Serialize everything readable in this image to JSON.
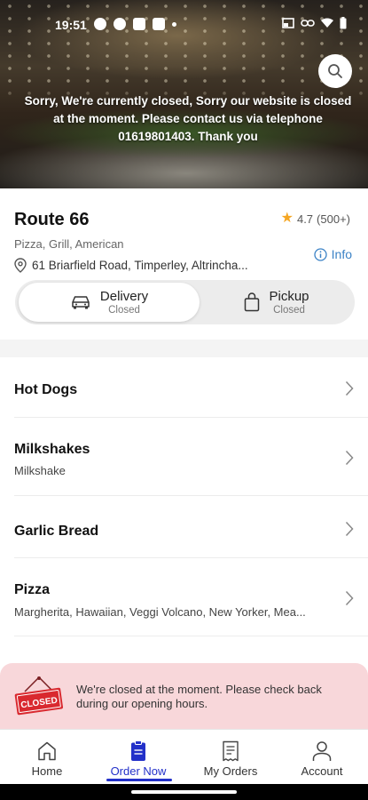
{
  "status_bar": {
    "time": "19:51"
  },
  "hero": {
    "closed_message": "Sorry, We're currently closed, Sorry our website is closed at the moment. Please contact us via telephone 01619801403. Thank you"
  },
  "restaurant": {
    "name": "Route 66",
    "rating": "4.7",
    "rating_count": "(500+)",
    "cuisine": "Pizza, Grill, American",
    "address": "61 Briarfield Road, Timperley, Altrincha...",
    "info_label": "Info"
  },
  "mode_toggle": {
    "delivery": {
      "label": "Delivery",
      "status": "Closed"
    },
    "pickup": {
      "label": "Pickup",
      "status": "Closed"
    }
  },
  "categories": [
    {
      "name": "Hot Dogs",
      "description": ""
    },
    {
      "name": "Milkshakes",
      "description": "Milkshake"
    },
    {
      "name": "Garlic Bread",
      "description": ""
    },
    {
      "name": "Pizza",
      "description": "Margherita, Hawaiian, Veggi Volcano, New Yorker, Mea..."
    }
  ],
  "closed_notice": {
    "sign_text": "CLOSED",
    "message": "We're closed at the moment. Please check back during our opening hours."
  },
  "bottom_nav": {
    "items": [
      {
        "label": "Home",
        "icon": "home-icon"
      },
      {
        "label": "Order Now",
        "icon": "order-icon"
      },
      {
        "label": "My Orders",
        "icon": "receipt-icon"
      },
      {
        "label": "Account",
        "icon": "person-icon"
      }
    ],
    "active_index": 1
  },
  "colors": {
    "accent": "#2230c9",
    "star": "#f5a623",
    "info": "#3b82c6",
    "closed_bg": "#f8d7da",
    "closed_sign": "#d9292f"
  }
}
